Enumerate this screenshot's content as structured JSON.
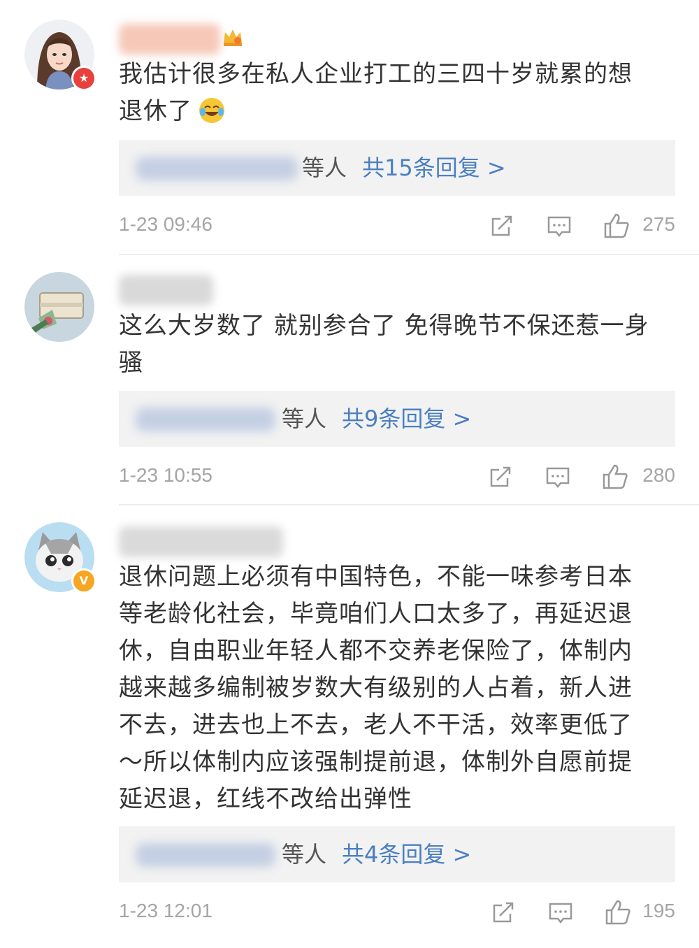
{
  "comments": [
    {
      "text_line1": "我估计很多在私人企业打工的三四十岁就累的想",
      "text_line2": "退休了",
      "reply_who": "等人",
      "reply_count": "共15条回复 >",
      "time": "1-23 09:46",
      "likes": "275",
      "badge_icon": "red-star-badge-icon"
    },
    {
      "text_line1": "这么大岁数了 就别参合了 免得晚节不保还惹一身",
      "text_line2": "骚",
      "reply_who": "等人",
      "reply_count": "共9条回复 >",
      "time": "1-23 10:55",
      "likes": "280"
    },
    {
      "lines": [
        "退休问题上必须有中国特色，不能一味参考日本",
        "等老龄化社会，毕竟咱们人口太多了，再延迟退",
        "休，自由职业年轻人都不交养老保险了，体制内",
        "越来越多编制被岁数大有级别的人占着，新人进",
        "不去，进去也上不去，老人不干活，效率更低了",
        "～所以体制内应该强制提前退，体制外自愿前提",
        "延迟退，红线不改给出弹性"
      ],
      "reply_who": "等人",
      "reply_count": "共4条回复 >",
      "time": "1-23 12:01",
      "likes": "195",
      "badge_icon": "verified-v-badge-icon"
    }
  ],
  "colors": {
    "link": "#4a7fc1",
    "meta": "#a5a5a5",
    "reply_bg": "#f2f2f2"
  }
}
